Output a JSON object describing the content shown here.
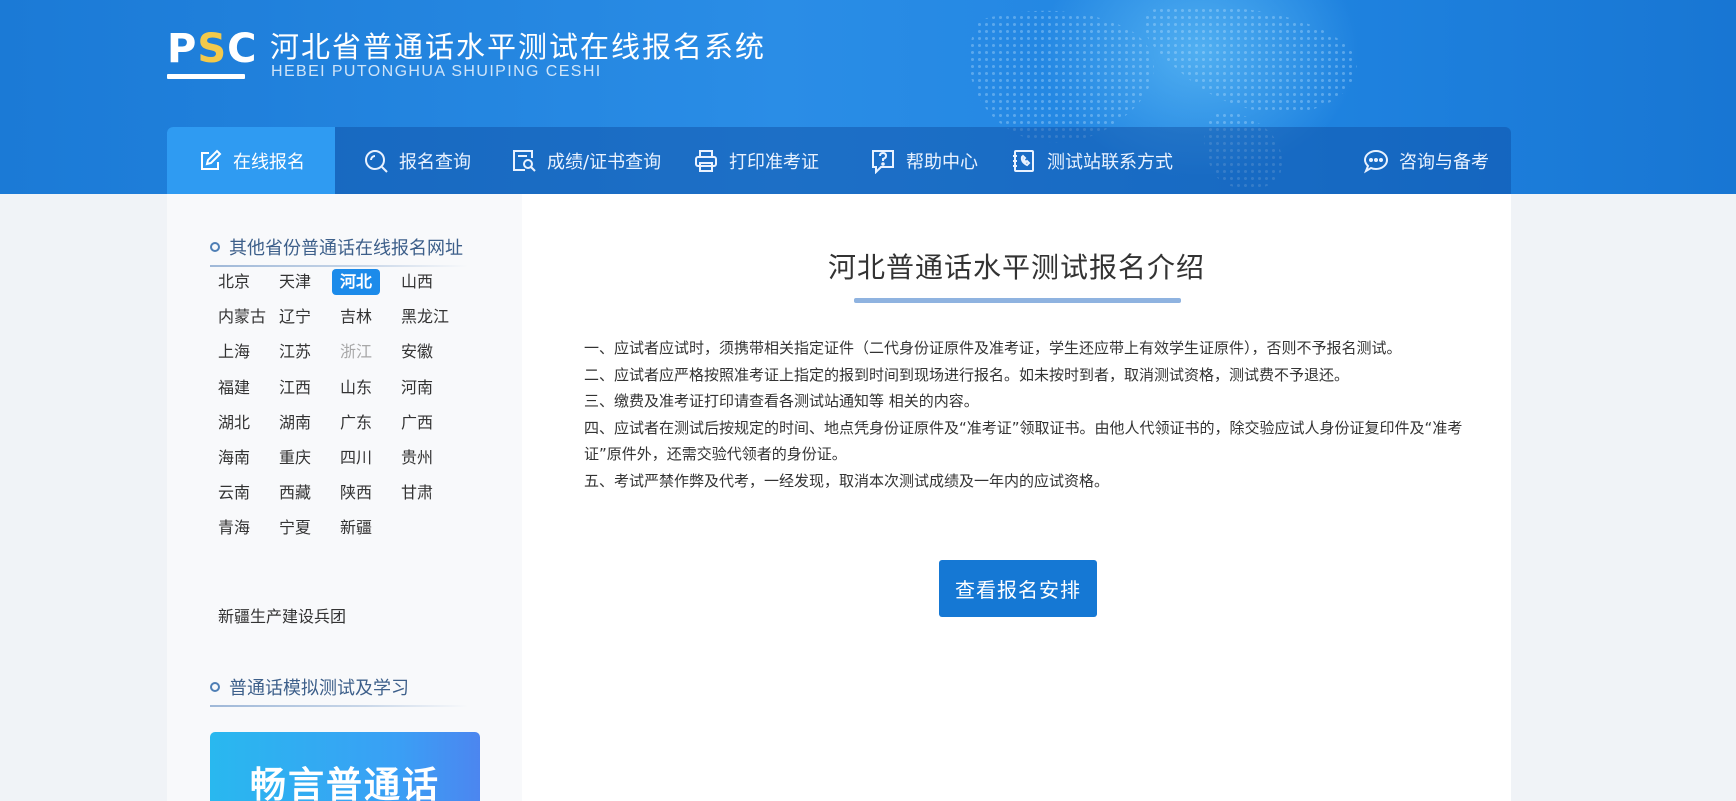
{
  "brand": {
    "logo_text": "PSC",
    "title": "河北省普通话水平测试在线报名系统",
    "subtitle": "HEBEI PUTONGHUA SHUIPING CESHI",
    "colors": {
      "header_blue": "#1f83e0",
      "active_tab": "#2f9bf2",
      "logo_gold": "#f3c94a",
      "button_blue": "#1578d4"
    }
  },
  "nav": {
    "items": [
      {
        "label": "在线报名",
        "icon": "edit-icon",
        "active": true
      },
      {
        "label": "报名查询",
        "icon": "search-icon",
        "active": false
      },
      {
        "label": "成绩/证书查询",
        "icon": "certificate-search-icon",
        "active": false
      },
      {
        "label": "打印准考证",
        "icon": "printer-icon",
        "active": false
      },
      {
        "label": "帮助中心",
        "icon": "help-icon",
        "active": false
      },
      {
        "label": "测试站联系方式",
        "icon": "phone-book-icon",
        "active": false
      }
    ],
    "right_item": {
      "label": "咨询与备考",
      "icon": "chat-icon"
    }
  },
  "sidebar": {
    "provinces_title": "其他省份普通话在线报名网址",
    "provinces": [
      [
        "北京",
        "天津",
        "河北",
        "山西"
      ],
      [
        "内蒙古",
        "辽宁",
        "吉林",
        "黑龙江"
      ],
      [
        "上海",
        "江苏",
        "浙江",
        "安徽"
      ],
      [
        "福建",
        "江西",
        "山东",
        "河南"
      ],
      [
        "湖北",
        "湖南",
        "广东",
        "广西"
      ],
      [
        "海南",
        "重庆",
        "四川",
        "贵州"
      ],
      [
        "云南",
        "西藏",
        "陕西",
        "甘肃"
      ],
      [
        "青海",
        "宁夏",
        "新疆"
      ]
    ],
    "selected_province": "河北",
    "disabled_province": "浙江",
    "extra_province": "新疆生产建设兵团",
    "practice_title": "普通话模拟测试及学习",
    "banner_text": "畅言普通话"
  },
  "main": {
    "title": "河北普通话水平测试报名介绍",
    "rules": [
      "一、应试者应试时，须携带相关指定证件（二代身份证原件及准考证，学生还应带上有效学生证原件），否则不予报名测试。",
      "二、应试者应严格按照准考证上指定的报到时间到现场进行报名。如未按时到者，取消测试资格，测试费不予退还。",
      "三、缴费及准考证打印请查看各测试站通知等 相关的内容。",
      "四、应试者在测试后按规定的时间、地点凭身份证原件及“准考证”领取证书。由他人代领证书的，除交验应试人身份证复印件及“准考证”原件外，还需交验代领者的身份证。",
      "五、考试严禁作弊及代考，一经发现，取消本次测试成绩及一年内的应试资格。"
    ],
    "button_label": "查看报名安排"
  }
}
